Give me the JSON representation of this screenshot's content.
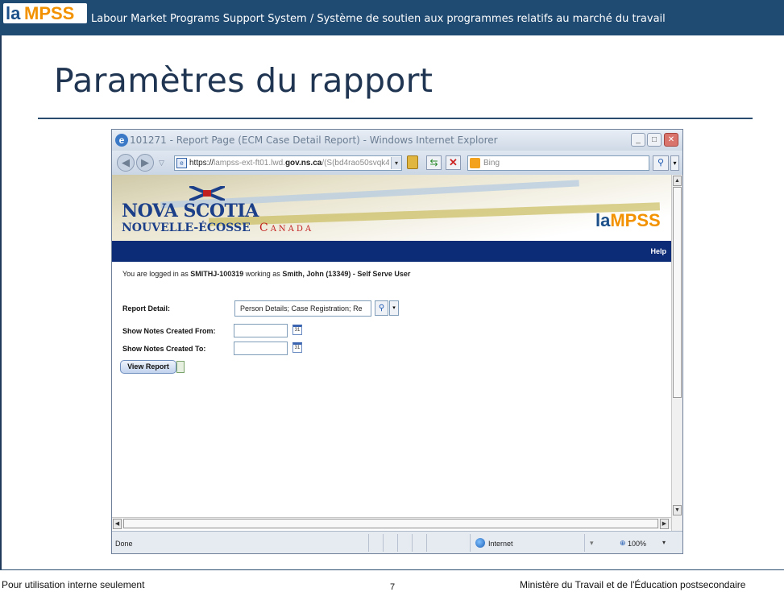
{
  "slide": {
    "logo_a": "la",
    "logo_b": "MPSS",
    "banner_text": "Labour Market Programs Support System / Système de soutien aux programmes relatifs au marché du travail",
    "title": "Paramètres du rapport",
    "footer_left": "Pour utilisation interne seulement",
    "page_number": "7",
    "footer_right": "Ministère du Travail et de l'Éducation postsecondaire",
    "colors": {
      "banner": "#1f4a72",
      "title": "#1f3552",
      "logo_orange": "#f39200",
      "logo_blue": "#1b4f8a"
    }
  },
  "browser": {
    "window_title": "101271 - Report Page (ECM Case Detail Report) - Windows Internet Explorer",
    "window_buttons": {
      "minimize": "_",
      "maximize": "□",
      "close": "✕"
    },
    "nav": {
      "back": "◀",
      "forward": "▶",
      "dropdown": "▽"
    },
    "url": {
      "scheme": "https://",
      "host_pre": "lampss-ext-ft01.lwd.",
      "host_bold": "gov.ns.ca",
      "path": "/(S(bd4rao50svqk4"
    },
    "search_placeholder": "Bing",
    "icons": {
      "refresh": "⇆",
      "stop": "✕",
      "search": "⚲",
      "dropdown": "▾"
    },
    "status": {
      "done": "Done",
      "zone": "Internet",
      "zoom": "100%",
      "zoom_icon": "⊕"
    }
  },
  "page": {
    "header": {
      "province": "NOVA SCOTIA",
      "province_fr": "NOUVELLE-ÉCOSSE",
      "country": "Canada",
      "logo_a": "la",
      "logo_b": "MPSS",
      "help": "Help"
    },
    "login": {
      "prefix": "You are logged in as ",
      "user": "SMITHJ-100319",
      "middle": " working as ",
      "role": "Smith, John (13349) - Self Serve User"
    },
    "form": {
      "report_detail_label": "Report Detail:",
      "report_detail_value": "Person Details; Case Registration; Re",
      "notes_from_label": "Show Notes Created From:",
      "notes_to_label": "Show Notes Created To:",
      "notes_from_value": "",
      "notes_to_value": "",
      "calendar_day": "31",
      "view_report": "View Report"
    }
  }
}
